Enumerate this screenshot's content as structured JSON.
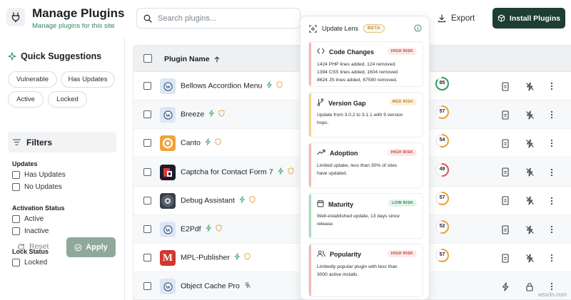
{
  "header": {
    "title": "Manage Plugins",
    "subtitle": "Manage plugins for this site",
    "search_placeholder": "Search plugins...",
    "export_label": "Export",
    "install_label": "Install Plugins"
  },
  "sidebar": {
    "quick_suggestions_title": "Quick Suggestions",
    "chips": [
      "Vulnerable",
      "Has Updates",
      "Active",
      "Locked"
    ],
    "filters_title": "Filters",
    "groups": [
      {
        "title": "Updates",
        "options": [
          "Has Updates",
          "No Updates"
        ]
      },
      {
        "title": "Activation Status",
        "options": [
          "Active",
          "Inactive"
        ]
      },
      {
        "title": "Lock Status",
        "options": [
          "Locked"
        ]
      }
    ],
    "reset_label": "Reset",
    "apply_label": "Apply"
  },
  "table": {
    "column_name": "Plugin Name",
    "rows": [
      {
        "name": "Bellows Accordion Menu",
        "score": "85",
        "score_value": 85,
        "score_color": "#2e9e5b",
        "icon": "wordpress-icon",
        "icon_bg": "#dde6f3",
        "icon_glyph": "W",
        "actions": "normal"
      },
      {
        "name": "Breeze",
        "score": "57",
        "score_value": 57,
        "score_color": "#e8a13a",
        "icon": "wordpress-icon",
        "icon_bg": "#dde6f3",
        "icon_glyph": "W",
        "actions": "normal"
      },
      {
        "name": "Canto",
        "score": "54",
        "score_value": 54,
        "score_color": "#e8a13a",
        "icon": "canto-icon",
        "icon_bg": "#f0a23b",
        "icon_glyph": "C",
        "actions": "normal"
      },
      {
        "name": "Captcha for Contact Form 7",
        "score": "49",
        "score_value": 49,
        "score_color": "#d9534f",
        "icon": "captcha-icon",
        "icon_bg": "#1c1c2e",
        "icon_glyph": "",
        "actions": "normal"
      },
      {
        "name": "Debug Assistant",
        "score": "57",
        "score_value": 57,
        "score_color": "#e8a13a",
        "icon": "debug-icon",
        "icon_bg": "#3a3f46",
        "icon_glyph": "",
        "actions": "normal"
      },
      {
        "name": "E2Pdf",
        "score": "52",
        "score_value": 52,
        "score_color": "#e8a13a",
        "icon": "wordpress-icon",
        "icon_bg": "#dde6f3",
        "icon_glyph": "W",
        "actions": "normal"
      },
      {
        "name": "MPL-Publisher",
        "score": "57",
        "score_value": 57,
        "score_color": "#e8a13a",
        "icon": "mpl-icon",
        "icon_bg": "#d0372f",
        "icon_glyph": "M",
        "actions": "normal"
      },
      {
        "name": "Object Cache Pro",
        "score": "",
        "score_value": 0,
        "score_color": "#e8a13a",
        "icon": "wordpress-icon",
        "icon_bg": "#dde6f3",
        "icon_glyph": "W",
        "actions": "locked"
      }
    ]
  },
  "lens": {
    "title": "Update Lens",
    "beta": "BETA",
    "cards": [
      {
        "title": "Code Changes",
        "risk": "HIGH RISK",
        "level": "high",
        "icon": "code-icon",
        "text": [
          "1424 PHP lines added, 124 removed.",
          "1394 CSS lines added, 1604 removed.",
          "8624 JS lines added, 67590 removed."
        ]
      },
      {
        "title": "Version Gap",
        "risk": "MED RISK",
        "level": "med",
        "icon": "branch-icon",
        "text": [
          "Update from 3.0.2 to 3.1.1 with 9 version",
          "hops."
        ]
      },
      {
        "title": "Adoption",
        "risk": "HIGH RISK",
        "level": "high",
        "icon": "trend-icon",
        "text": [
          "Limited uptake, less than 30% of sites",
          "have updated."
        ]
      },
      {
        "title": "Maturity",
        "risk": "LOW RISK",
        "level": "low",
        "icon": "calendar-icon",
        "text": [
          "Well-established update, 13 days since",
          "release."
        ]
      },
      {
        "title": "Popularity",
        "risk": "HIGH RISK",
        "level": "high",
        "icon": "users-icon",
        "text": [
          "Limitedly popular plugin with less than",
          "3000 active installs."
        ]
      }
    ]
  },
  "colors": {
    "brand": "#1e3d33",
    "accent_green": "#2f8a5a",
    "high": "#d9534f",
    "med": "#e8a13a",
    "low": "#2e9e5b"
  },
  "watermark": "wsxdn.com"
}
